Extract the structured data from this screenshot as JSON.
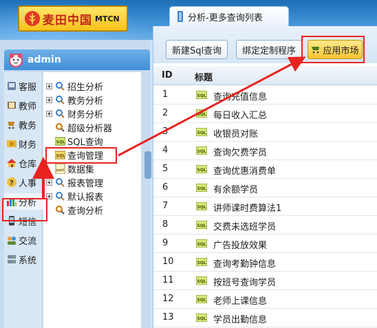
{
  "header": {
    "logo_text": "麦田中国",
    "logo_sub": "MTCN",
    "tab_label": "分析-更多查询列表"
  },
  "user": {
    "name": "admin"
  },
  "categories": [
    {
      "label": "客服",
      "icon": "headset-icon"
    },
    {
      "label": "教师",
      "icon": "book-icon"
    },
    {
      "label": "教务",
      "icon": "cart-icon"
    },
    {
      "label": "财务",
      "icon": "money-icon"
    },
    {
      "label": "仓库",
      "icon": "house-icon"
    },
    {
      "label": "人事",
      "icon": "question-icon"
    },
    {
      "label": "分析",
      "icon": "bar-chart-icon"
    },
    {
      "label": "短信",
      "icon": "phone-icon"
    },
    {
      "label": "交流",
      "icon": "users-icon"
    },
    {
      "label": "系统",
      "icon": "server-icon"
    }
  ],
  "tree": [
    {
      "label": "招生分析",
      "expandable": true,
      "icon": "analysis-icon"
    },
    {
      "label": "教务分析",
      "expandable": true,
      "icon": "analysis-icon"
    },
    {
      "label": "财务分析",
      "expandable": true,
      "icon": "analysis-icon"
    },
    {
      "label": "超级分析器",
      "expandable": false,
      "icon": "magnifier-icon"
    },
    {
      "label": "SQL查询",
      "expandable": false,
      "icon": "sql-icon"
    },
    {
      "label": "查询管理",
      "expandable": false,
      "icon": "sql-manage-icon"
    },
    {
      "label": "数据集",
      "expandable": false,
      "icon": "xml-icon"
    },
    {
      "label": "报表管理",
      "expandable": true,
      "icon": "report-icon"
    },
    {
      "label": "默认报表",
      "expandable": true,
      "icon": "report-icon"
    },
    {
      "label": "查询分析",
      "expandable": false,
      "icon": "magnifier-icon"
    }
  ],
  "toolbar": {
    "new_sql_label": "新建Sql查询",
    "bind_program_label": "绑定定制程序",
    "app_market_label": "应用市场"
  },
  "table": {
    "columns": [
      "ID",
      "标题"
    ],
    "rows": [
      {
        "id": "1",
        "title": "查询充值信息"
      },
      {
        "id": "2",
        "title": "每日收入汇总"
      },
      {
        "id": "3",
        "title": "收银员对账"
      },
      {
        "id": "4",
        "title": "查询欠费学员"
      },
      {
        "id": "5",
        "title": "查询优惠消费单"
      },
      {
        "id": "6",
        "title": "有余额学员"
      },
      {
        "id": "7",
        "title": "讲师课时费算法1"
      },
      {
        "id": "8",
        "title": "交费未选班学员"
      },
      {
        "id": "9",
        "title": "广告投放效果"
      },
      {
        "id": "10",
        "title": "查询考勤钟信息"
      },
      {
        "id": "11",
        "title": "按班号查询学员"
      },
      {
        "id": "12",
        "title": "老师上课信息"
      },
      {
        "id": "13",
        "title": "学员出勤信息"
      }
    ]
  },
  "colors": {
    "highlight": "#e8231f",
    "accent": "#3f8fd6",
    "gold": "#f6c533"
  }
}
